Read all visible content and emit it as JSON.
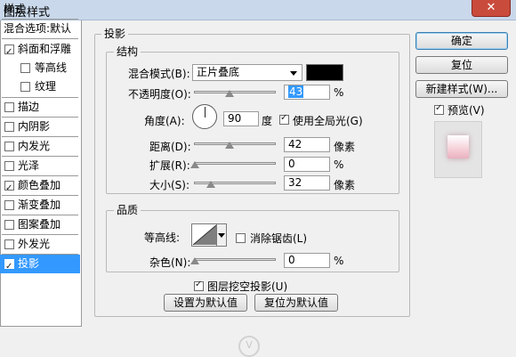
{
  "window": {
    "title": "图层样式",
    "close_label": "✕"
  },
  "left_panel": {
    "header": "样式",
    "blend_defaults": "混合选项:默认",
    "items": [
      {
        "label": "斜面和浮雕",
        "checked": true
      },
      {
        "label": "等高线",
        "checked": false
      },
      {
        "label": "纹理",
        "checked": false
      },
      {
        "label": "描边",
        "checked": false
      },
      {
        "label": "内阴影",
        "checked": false
      },
      {
        "label": "内发光",
        "checked": false
      },
      {
        "label": "光泽",
        "checked": false
      },
      {
        "label": "颜色叠加",
        "checked": true
      },
      {
        "label": "渐变叠加",
        "checked": false
      },
      {
        "label": "图案叠加",
        "checked": false
      },
      {
        "label": "外发光",
        "checked": false
      },
      {
        "label": "投影",
        "checked": true,
        "selected": true
      }
    ]
  },
  "drop_shadow": {
    "section_title": "投影",
    "structure_title": "结构",
    "blend_mode_label": "混合模式(B):",
    "blend_mode_value": "正片叠底",
    "shadow_color": "#000000",
    "opacity_label": "不透明度(O):",
    "opacity_value": "43",
    "opacity_unit": "%",
    "angle_label": "角度(A):",
    "angle_value": "90",
    "angle_unit": "度",
    "global_light_label": "使用全局光(G)",
    "global_light_checked": true,
    "distance_label": "距离(D):",
    "distance_value": "42",
    "distance_unit": "像素",
    "spread_label": "扩展(R):",
    "spread_value": "0",
    "spread_unit": "%",
    "size_label": "大小(S):",
    "size_value": "32",
    "size_unit": "像素",
    "quality_title": "品质",
    "contour_label": "等高线:",
    "anti_alias_label": "消除锯齿(L)",
    "anti_alias_checked": false,
    "noise_label": "杂色(N):",
    "noise_value": "0",
    "noise_unit": "%",
    "knockout_label": "图层挖空投影(U)",
    "knockout_checked": true,
    "set_default_label": "设置为默认值",
    "reset_default_label": "复位为默认值"
  },
  "buttons": {
    "ok": "确定",
    "reset": "复位",
    "new_style": "新建样式(W)...",
    "preview_label": "预览(V)",
    "preview_checked": true
  },
  "watermark": "V",
  "colors": {
    "selection": "#3399ff",
    "title_bar": "#c9d8ea",
    "close": "#c94b3c"
  }
}
